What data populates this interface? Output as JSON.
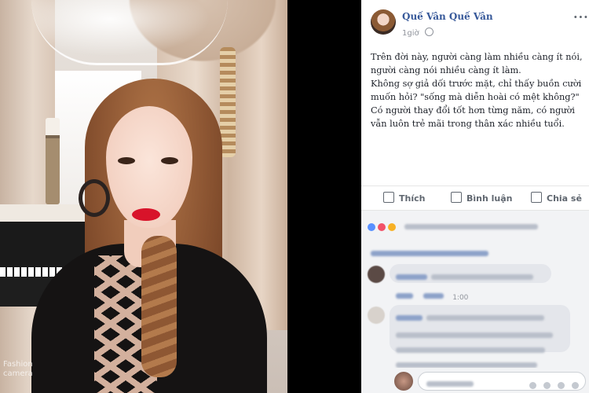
{
  "photo": {
    "watermark_line1": "Fashion",
    "watermark_line2": "camera"
  },
  "post": {
    "author_name": "Quế Vân Quế Vân",
    "timestamp": "1giờ",
    "privacy_icon": "globe-icon",
    "content": [
      "Trên đời này, người càng làm nhiều càng ít nói, người càng nói nhiều càng ít làm.",
      "Không sợ giả dối trước mặt, chỉ thấy buồn cười muốn hỏi? \"sống mà diễn hoài có mệt không?\"",
      "Có người thay đổi tốt hơn từng năm, có người vẫn luôn trẻ mãi trong thân xác nhiều tuổi."
    ],
    "actions": {
      "like": "Thích",
      "comment": "Bình luận",
      "share": "Chia sẻ"
    }
  },
  "comments_section": {
    "first_comment_time": "1:00",
    "reaction_colors": [
      "#5890ff",
      "#f25268",
      "#f7b125"
    ]
  }
}
